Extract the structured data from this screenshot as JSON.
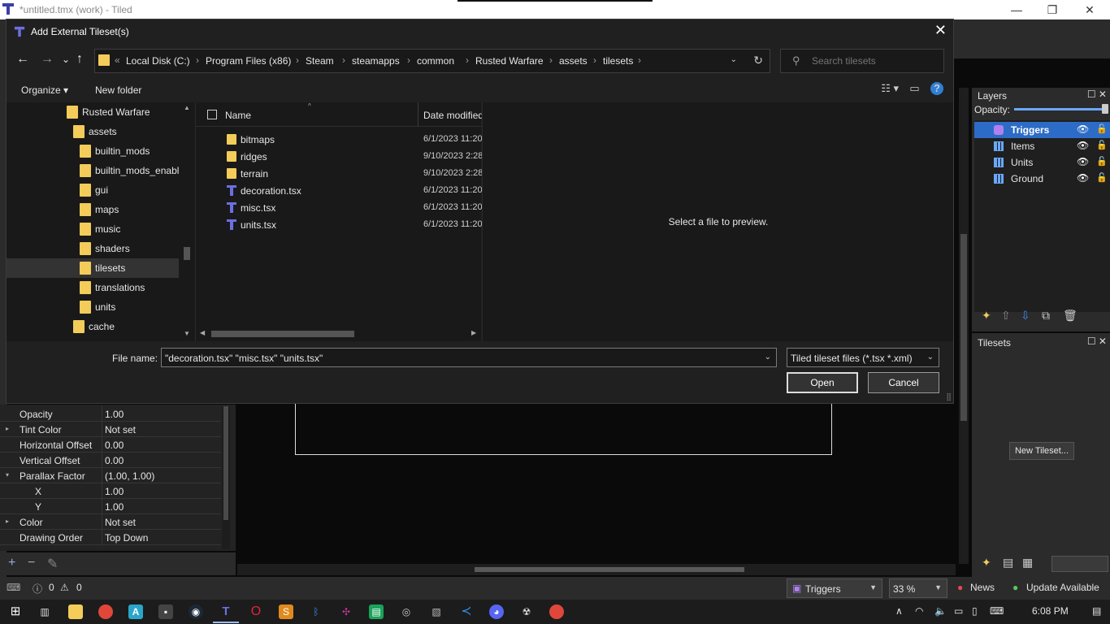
{
  "window": {
    "title": "*untitled.tmx (work) - Tiled",
    "minimize_glyph": "—",
    "maximize_glyph": "❐",
    "close_glyph": "✕"
  },
  "dialog": {
    "title": "Add External Tileset(s)",
    "close_glyph": "✕",
    "nav": {
      "back": "←",
      "forward": "→",
      "recent": "⌄",
      "up": "↑"
    },
    "address": {
      "prefix": "«",
      "segments": [
        "Local Disk (C:)",
        "Program Files (x86)",
        "Steam",
        "steamapps",
        "common",
        "Rusted Warfare",
        "assets",
        "tilesets"
      ],
      "separator": "›",
      "dropdown": "⌄",
      "refresh": "↻"
    },
    "search": {
      "placeholder": "Search tilesets",
      "icon": "⚲"
    },
    "commands": {
      "organize": "Organize ▾",
      "new_folder": "New folder",
      "view": "☷ ▾",
      "pane": "▭",
      "help": "?"
    },
    "tree": [
      {
        "name": "Rusted Warfare",
        "level": 0
      },
      {
        "name": "assets",
        "level": 1
      },
      {
        "name": "builtin_mods",
        "level": 2
      },
      {
        "name": "builtin_mods_enabl",
        "level": 2
      },
      {
        "name": "gui",
        "level": 2
      },
      {
        "name": "maps",
        "level": 2
      },
      {
        "name": "music",
        "level": 2
      },
      {
        "name": "shaders",
        "level": 2
      },
      {
        "name": "tilesets",
        "level": 2,
        "selected": true
      },
      {
        "name": "translations",
        "level": 2
      },
      {
        "name": "units",
        "level": 2
      },
      {
        "name": "cache",
        "level": 1
      }
    ],
    "columns": {
      "name": "Name",
      "date": "Date modified",
      "sort": "^"
    },
    "files": [
      {
        "name": "bitmaps",
        "date": "6/1/2023 11:20",
        "kind": "folder"
      },
      {
        "name": "ridges",
        "date": "9/10/2023 2:28",
        "kind": "folder"
      },
      {
        "name": "terrain",
        "date": "9/10/2023 2:28",
        "kind": "folder"
      },
      {
        "name": "decoration.tsx",
        "date": "6/1/2023 11:20",
        "kind": "tsx"
      },
      {
        "name": "misc.tsx",
        "date": "6/1/2023 11:20",
        "kind": "tsx"
      },
      {
        "name": "units.tsx",
        "date": "6/1/2023 11:20",
        "kind": "tsx"
      }
    ],
    "preview_text": "Select a file to preview.",
    "file_name_label": "File name:",
    "file_name_value": "\"decoration.tsx\" \"misc.tsx\" \"units.tsx\"",
    "filter": "Tiled tileset files (*.tsx *.xml)",
    "open_label": "Open",
    "cancel_label": "Cancel"
  },
  "properties": [
    {
      "name": "Opacity",
      "value": "1.00",
      "expander": ""
    },
    {
      "name": "Tint Color",
      "value": "Not set",
      "expander": "▸"
    },
    {
      "name": "Horizontal Offset",
      "value": "0.00",
      "expander": ""
    },
    {
      "name": "Vertical Offset",
      "value": "0.00",
      "expander": ""
    },
    {
      "name": "Parallax Factor",
      "value": "(1.00, 1.00)",
      "expander": "▾"
    },
    {
      "name": "X",
      "value": "1.00",
      "expander": "",
      "sub": true
    },
    {
      "name": "Y",
      "value": "1.00",
      "expander": "",
      "sub": true
    },
    {
      "name": "Color",
      "value": "Not set",
      "expander": "▸"
    },
    {
      "name": "Drawing Order",
      "value": "Top Down",
      "expander": ""
    }
  ],
  "props_tools": {
    "add": "+",
    "remove": "−",
    "edit": "✎"
  },
  "layers": {
    "title": "Layers",
    "opacity_label": "Opacity:",
    "opacity": 0.93,
    "items": [
      {
        "name": "Triggers",
        "selected": true,
        "kind": "object"
      },
      {
        "name": "Items",
        "kind": "tile"
      },
      {
        "name": "Units",
        "kind": "tile"
      },
      {
        "name": "Ground",
        "kind": "tile"
      }
    ],
    "eye_glyph": "👁",
    "lock_glyph": "🔓"
  },
  "tilesets": {
    "title": "Tilesets",
    "new_tileset_label": "New Tileset..."
  },
  "status": {
    "errors": "0",
    "warnings": "0",
    "layer_combo": "Triggers",
    "zoom": "33 %",
    "news": "News",
    "update": "Update Available"
  },
  "taskbar": {
    "time": "6:08 PM"
  },
  "colors": {
    "accent": "#2d6cc6",
    "folder": "#f3cc5a",
    "dialog_bg": "#202020",
    "help_blue": "#2f7fd6"
  }
}
